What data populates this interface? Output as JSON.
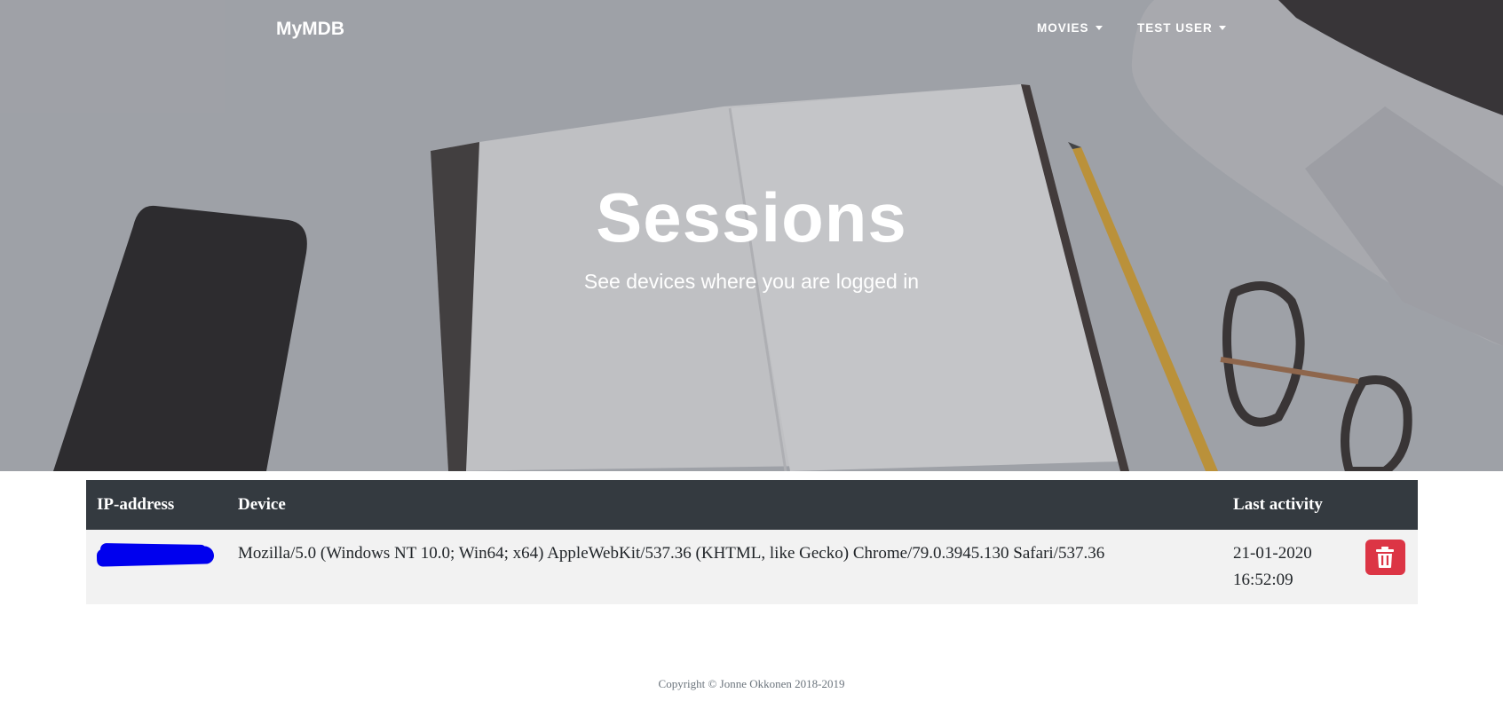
{
  "navbar": {
    "brand": "MyMDB",
    "items": [
      {
        "label": "MOVIES"
      },
      {
        "label": "TEST USER"
      }
    ]
  },
  "hero": {
    "title": "Sessions",
    "subtitle": "See devices where you are logged in"
  },
  "sessions_table": {
    "columns": [
      "IP-address",
      "Device",
      "Last activity",
      ""
    ],
    "rows": [
      {
        "ip": "",
        "device": "Mozilla/5.0 (Windows NT 10.0; Win64; x64) AppleWebKit/537.36 (KHTML, like Gecko) Chrome/79.0.3945.130 Safari/537.36",
        "last_activity_date": "21-01-2020",
        "last_activity_time": "16:52:09"
      }
    ]
  },
  "footer": {
    "copyright": "Copyright © Jonne Okkonen 2018-2019"
  },
  "colors": {
    "table_header": "#343a40",
    "row_bg": "#f2f2f2",
    "danger": "#dc3545",
    "redaction": "#0000ee"
  }
}
